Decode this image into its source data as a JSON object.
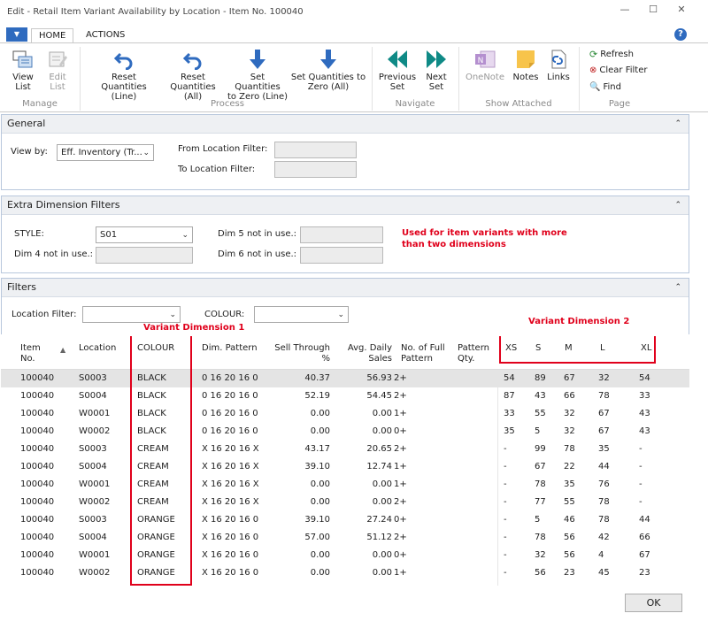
{
  "window": {
    "title": "Edit - Retail Item Variant Availability by Location - Item No. 100040",
    "min": "—",
    "max": "☐",
    "close": "✕"
  },
  "ribbon": {
    "tabs": {
      "home": "HOME",
      "actions": "ACTIONS"
    },
    "manage": {
      "group": "Manage",
      "view_list": [
        "View",
        "List"
      ],
      "edit_list": [
        "Edit",
        "List"
      ]
    },
    "process": {
      "group": "Process",
      "reset_line": [
        "Reset",
        "Quantities (Line)"
      ],
      "reset_all": [
        "Reset",
        "Quantities (All)"
      ],
      "zero_line": [
        "Set Quantities",
        "to Zero (Line)"
      ],
      "zero_all": [
        "Set Quantities to",
        "Zero (All)"
      ]
    },
    "navigate": {
      "group": "Navigate",
      "prev": [
        "Previous",
        "Set"
      ],
      "next": [
        "Next",
        "Set"
      ]
    },
    "attached": {
      "group": "Show Attached",
      "onenote": "OneNote",
      "notes": "Notes",
      "links": "Links"
    },
    "page": {
      "group": "Page",
      "refresh": "Refresh",
      "clear_filter": "Clear Filter",
      "find": "Find"
    }
  },
  "general": {
    "title": "General",
    "view_by_label": "View by:",
    "view_by_value": "Eff. Inventory (Tr...",
    "from_location_label": "From Location Filter:",
    "to_location_label": "To Location Filter:"
  },
  "extra": {
    "title": "Extra Dimension Filters",
    "style_label": "STYLE:",
    "style_value": "S01",
    "dim4_label": "Dim 4 not in use.:",
    "dim5_label": "Dim 5 not in use.:",
    "dim6_label": "Dim 6 not in use.:",
    "note_line1": "Used for item variants with more",
    "note_line2": "than two dimensions"
  },
  "filters": {
    "title": "Filters",
    "location_label": "Location Filter:",
    "colour_label": "COLOUR:",
    "variant_dim1": "Variant Dimension 1",
    "variant_dim2": "Variant Dimension 2"
  },
  "grid": {
    "headers": {
      "item_no": [
        "Item",
        "No."
      ],
      "location": "Location",
      "colour": "COLOUR",
      "dim_pattern": "Dim. Pattern",
      "sell_through": [
        "Sell Through",
        "%"
      ],
      "avg_daily": [
        "Avg. Daily",
        "Sales"
      ],
      "full_pattern": [
        "No. of Full",
        "Pattern"
      ],
      "pattern_qty": [
        "Pattern",
        "Qty."
      ],
      "xs": "XS",
      "s": "S",
      "m": "M",
      "l": "L",
      "xl": "XL"
    },
    "rows": [
      {
        "item": "100040",
        "loc": "S0003",
        "colour": "BLACK",
        "pattern": "0  16  20  16  0",
        "sell": "40.37",
        "avg": "56.93",
        "full": "2+",
        "xs": "54",
        "s": "89",
        "m": "67",
        "l": "32",
        "xl": "54"
      },
      {
        "item": "100040",
        "loc": "S0004",
        "colour": "BLACK",
        "pattern": "0  16  20  16  0",
        "sell": "52.19",
        "avg": "54.45",
        "full": "2+",
        "xs": "87",
        "s": "43",
        "m": "66",
        "l": "78",
        "xl": "33"
      },
      {
        "item": "100040",
        "loc": "W0001",
        "colour": "BLACK",
        "pattern": "0  16  20  16  0",
        "sell": "0.00",
        "avg": "0.00",
        "full": "1+",
        "xs": "33",
        "s": "55",
        "m": "32",
        "l": "67",
        "xl": "43"
      },
      {
        "item": "100040",
        "loc": "W0002",
        "colour": "BLACK",
        "pattern": "0  16  20  16  0",
        "sell": "0.00",
        "avg": "0.00",
        "full": "0+",
        "xs": "35",
        "s": "5",
        "m": "32",
        "l": "67",
        "xl": "43"
      },
      {
        "item": "100040",
        "loc": "S0003",
        "colour": "CREAM",
        "pattern": "X  16  20  16  X",
        "sell": "43.17",
        "avg": "20.65",
        "full": "2+",
        "xs": "-",
        "s": "99",
        "m": "78",
        "l": "35",
        "xl": "-"
      },
      {
        "item": "100040",
        "loc": "S0004",
        "colour": "CREAM",
        "pattern": "X  16  20  16  X",
        "sell": "39.10",
        "avg": "12.74",
        "full": "1+",
        "xs": "-",
        "s": "67",
        "m": "22",
        "l": "44",
        "xl": "-"
      },
      {
        "item": "100040",
        "loc": "W0001",
        "colour": "CREAM",
        "pattern": "X  16  20  16  X",
        "sell": "0.00",
        "avg": "0.00",
        "full": "1+",
        "xs": "-",
        "s": "78",
        "m": "35",
        "l": "76",
        "xl": "-"
      },
      {
        "item": "100040",
        "loc": "W0002",
        "colour": "CREAM",
        "pattern": "X  16  20  16  X",
        "sell": "0.00",
        "avg": "0.00",
        "full": "2+",
        "xs": "-",
        "s": "77",
        "m": "55",
        "l": "78",
        "xl": "-"
      },
      {
        "item": "100040",
        "loc": "S0003",
        "colour": "ORANGE",
        "pattern": "X  16  20  16  0",
        "sell": "39.10",
        "avg": "27.24",
        "full": "0+",
        "xs": "-",
        "s": "5",
        "m": "46",
        "l": "78",
        "xl": "44"
      },
      {
        "item": "100040",
        "loc": "S0004",
        "colour": "ORANGE",
        "pattern": "X  16  20  16  0",
        "sell": "57.00",
        "avg": "51.12",
        "full": "2+",
        "xs": "-",
        "s": "78",
        "m": "56",
        "l": "42",
        "xl": "66"
      },
      {
        "item": "100040",
        "loc": "W0001",
        "colour": "ORANGE",
        "pattern": "X  16  20  16  0",
        "sell": "0.00",
        "avg": "0.00",
        "full": "0+",
        "xs": "-",
        "s": "32",
        "m": "56",
        "l": "4",
        "xl": "67"
      },
      {
        "item": "100040",
        "loc": "W0002",
        "colour": "ORANGE",
        "pattern": "X  16  20  16  0",
        "sell": "0.00",
        "avg": "0.00",
        "full": "1+",
        "xs": "-",
        "s": "56",
        "m": "23",
        "l": "45",
        "xl": "23"
      }
    ]
  },
  "ok": "OK"
}
